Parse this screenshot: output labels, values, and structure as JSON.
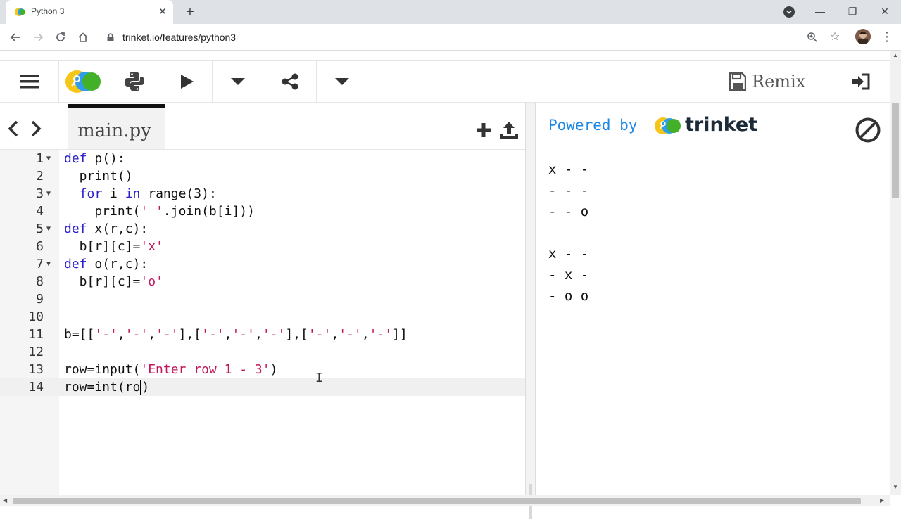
{
  "browser": {
    "tab_title": "Python 3",
    "url": "trinket.io/features/python3",
    "window_controls": [
      "minimize",
      "restore",
      "close"
    ]
  },
  "trinket_toolbar": {
    "remix_label": "Remix"
  },
  "editor": {
    "file_tab": "main.py",
    "lines": [
      {
        "n": "1",
        "fold": true
      },
      {
        "n": "2",
        "fold": false
      },
      {
        "n": "3",
        "fold": true
      },
      {
        "n": "4",
        "fold": false
      },
      {
        "n": "5",
        "fold": true
      },
      {
        "n": "6",
        "fold": false
      },
      {
        "n": "7",
        "fold": true
      },
      {
        "n": "8",
        "fold": false
      },
      {
        "n": "9",
        "fold": false
      },
      {
        "n": "10",
        "fold": false
      },
      {
        "n": "11",
        "fold": false
      },
      {
        "n": "12",
        "fold": false
      },
      {
        "n": "13",
        "fold": false
      },
      {
        "n": "14",
        "fold": false
      }
    ],
    "code": {
      "l1_kw": "def",
      "l1_rest": " p():",
      "l2": "  print()",
      "l3_kw1": "for",
      "l3_a": " i ",
      "l3_kw2": "in",
      "l3_b": " range(3):",
      "l4_a": "    print(",
      "l4_str": "' '",
      "l4_b": ".join(b[i]))",
      "l5_kw": "def",
      "l5_rest": " x(r,c):",
      "l6_a": "  b[r][c]=",
      "l6_str": "'x'",
      "l7_kw": "def",
      "l7_rest": " o(r,c):",
      "l8_a": "  b[r][c]=",
      "l8_str": "'o'",
      "l11_a": "b=[[",
      "l11_s1": "'-'",
      "l11_c1": ",",
      "l11_s2": "'-'",
      "l11_c2": ",",
      "l11_s3": "'-'",
      "l11_m1": "],[",
      "l11_s4": "'-'",
      "l11_c3": ",",
      "l11_s5": "'-'",
      "l11_c4": ",",
      "l11_s6": "'-'",
      "l11_m2": "],[",
      "l11_s7": "'-'",
      "l11_c5": ",",
      "l11_s8": "'-'",
      "l11_c6": ",",
      "l11_s9": "'-'",
      "l11_end": "]]",
      "l13_a": "row=input(",
      "l13_str": "'Enter row 1 - 3'",
      "l13_b": ")",
      "l14_a": "row=int(ro",
      "l14_b": ")"
    }
  },
  "output": {
    "powered_by": "Powered by",
    "brand": "trinket",
    "lines": [
      "x - -",
      "- - -",
      "- - o",
      "",
      "x - -",
      "- x -",
      "- o o"
    ]
  }
}
